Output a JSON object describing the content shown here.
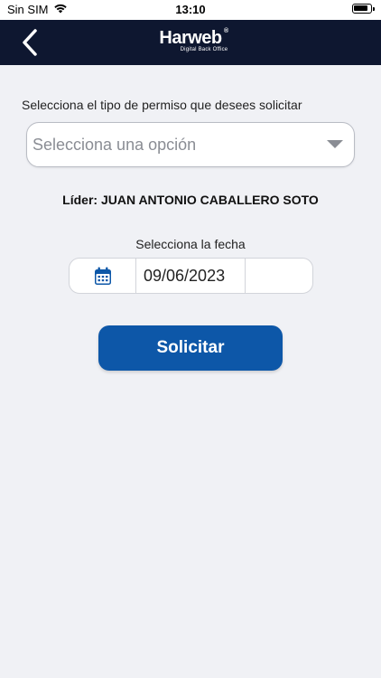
{
  "status_bar": {
    "carrier": "Sin SIM",
    "time": "13:10"
  },
  "nav": {
    "logo": "Harweb",
    "logo_reg": "®",
    "logo_subtitle": "Digital Back Office"
  },
  "form": {
    "prompt": "Selecciona el tipo de permiso que desees solicitar",
    "select_placeholder": "Selecciona una opción",
    "leader": "Líder: JUAN ANTONIO CABALLERO SOTO",
    "date_label": "Selecciona la fecha",
    "date_value": "09/06/2023",
    "submit_label": "Solicitar"
  },
  "colors": {
    "nav_background": "#0e1730",
    "accent": "#0d57a8",
    "page_background": "#f0f1f5"
  }
}
